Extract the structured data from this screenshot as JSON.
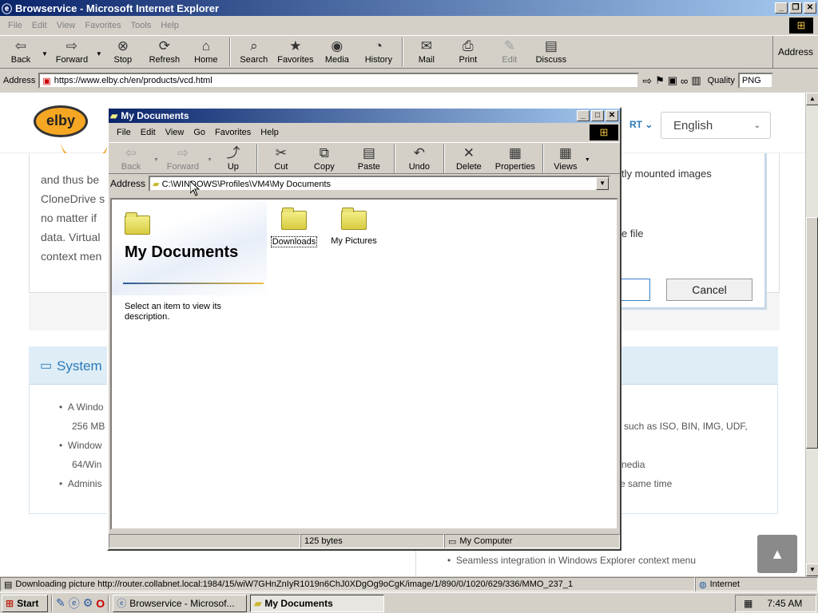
{
  "ie": {
    "title": "Browservice - Microsoft Internet Explorer",
    "menu": [
      "File",
      "Edit",
      "View",
      "Favorites",
      "Tools",
      "Help"
    ],
    "toolbar": {
      "back": "Back",
      "forward": "Forward",
      "stop": "Stop",
      "refresh": "Refresh",
      "home": "Home",
      "search": "Search",
      "favorites": "Favorites",
      "media": "Media",
      "history": "History",
      "mail": "Mail",
      "print": "Print",
      "edit": "Edit",
      "discuss": "Discuss"
    },
    "address_label": "Address",
    "address_right_label": "Address",
    "url": "https://www.elby.ch/en/products/vcd.html",
    "quality_label": "Quality",
    "quality_value": "PNG",
    "status_text": "Downloading picture http://router.collabnet.local:1984/15/wiW7GHnZnIyR1019n6ChJ0XDgOg9oCgK/image/1/890/0/1020/629/336/MMO_237_1",
    "status_zone": "Internet"
  },
  "web": {
    "logo": "elby",
    "language": "English",
    "support_fragment": "RT",
    "body_lines": [
      "and thus be",
      "CloneDrive s",
      "no matter if",
      "data. Virtual",
      "context men"
    ],
    "right_lines": [
      "tly mounted images",
      "e file"
    ],
    "cancel_button": "Cancel",
    "system_heading": "System",
    "req_lines": [
      "A Windo",
      "256 MB",
      "Window",
      "64/Win",
      "Adminis"
    ],
    "feature_lines": [
      "such as ISO, BIN, IMG, UDF,",
      "nedia",
      "e same time"
    ],
    "bottom_feature": "Seamless integration in Windows Explorer context menu"
  },
  "explorer": {
    "title": "My Documents",
    "menu": [
      "File",
      "Edit",
      "View",
      "Go",
      "Favorites",
      "Help"
    ],
    "toolbar": {
      "back": "Back",
      "forward": "Forward",
      "up": "Up",
      "cut": "Cut",
      "copy": "Copy",
      "paste": "Paste",
      "undo": "Undo",
      "delete": "Delete",
      "properties": "Properties",
      "views": "Views"
    },
    "address_label": "Address",
    "path": "C:\\WINDOWS\\Profiles\\VM4\\My Documents",
    "panel_title": "My Documents",
    "panel_desc": "Select an item to view its description.",
    "items": [
      "Downloads",
      "My Pictures"
    ],
    "status_size": "125 bytes",
    "status_location": "My Computer"
  },
  "taskbar": {
    "start": "Start",
    "tasks": [
      "Browservice - Microsof...",
      "My Documents"
    ],
    "clock": "7:45 AM"
  }
}
